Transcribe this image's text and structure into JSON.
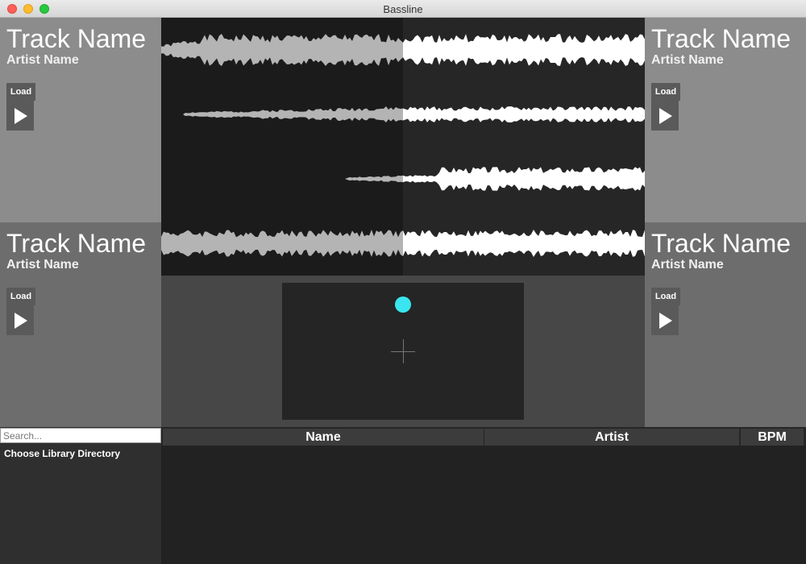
{
  "window": {
    "title": "Bassline"
  },
  "decks": {
    "top_left": {
      "track_name": "Track Name",
      "artist_name": "Artist Name",
      "load_label": "Load"
    },
    "top_right": {
      "track_name": "Track Name",
      "artist_name": "Artist Name",
      "load_label": "Load"
    },
    "bottom_left": {
      "track_name": "Track Name",
      "artist_name": "Artist Name",
      "load_label": "Load"
    },
    "bottom_right": {
      "track_name": "Track Name",
      "artist_name": "Artist Name",
      "load_label": "Load"
    }
  },
  "xy_pad": {
    "dot_color": "#39e6ef"
  },
  "library": {
    "search_placeholder": "Search...",
    "search_value": "",
    "choose_directory_label": "Choose Library Directory"
  },
  "table": {
    "columns": [
      "Name",
      "Artist",
      "BPM"
    ],
    "rows": []
  },
  "colors": {
    "deck_top_bg": "#8c8c8c",
    "deck_bottom_bg": "#6d6d6d",
    "waveform_played": "#b4b4b4",
    "waveform_unplayed": "#ffffff"
  }
}
